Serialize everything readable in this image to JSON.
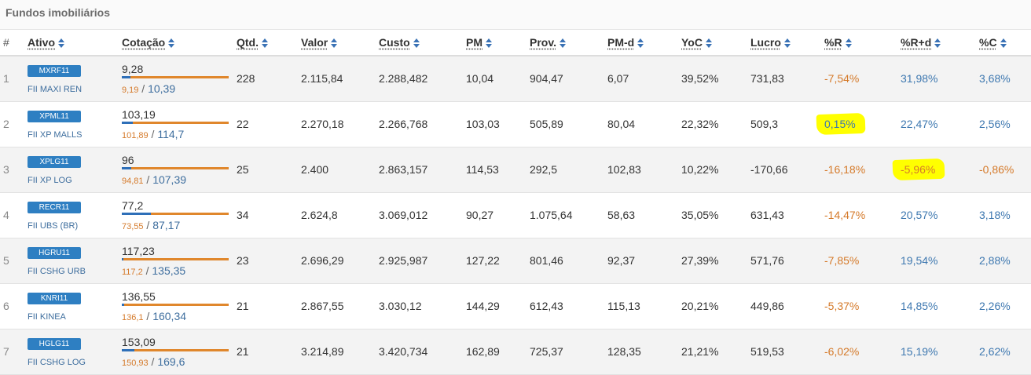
{
  "panel": {
    "title": "Fundos imobiliários"
  },
  "columns": [
    {
      "key": "num",
      "label": "#",
      "sortable": false
    },
    {
      "key": "ativo",
      "label": "Ativo",
      "sortable": true
    },
    {
      "key": "cotacao",
      "label": "Cotação",
      "sortable": true
    },
    {
      "key": "qtd",
      "label": "Qtd.",
      "sortable": true
    },
    {
      "key": "valor",
      "label": "Valor",
      "sortable": true
    },
    {
      "key": "custo",
      "label": "Custo",
      "sortable": true
    },
    {
      "key": "pm",
      "label": "PM",
      "sortable": true
    },
    {
      "key": "prov",
      "label": "Prov.",
      "sortable": true
    },
    {
      "key": "pmd",
      "label": "PM-d",
      "sortable": true
    },
    {
      "key": "yoc",
      "label": "YoC",
      "sortable": true
    },
    {
      "key": "lucro",
      "label": "Lucro",
      "sortable": true
    },
    {
      "key": "r",
      "label": "%R",
      "sortable": true
    },
    {
      "key": "rd",
      "label": "%R+d",
      "sortable": true
    },
    {
      "key": "c",
      "label": "%C",
      "sortable": true
    }
  ],
  "rows": [
    {
      "num": "1",
      "ticker": "MXRF11",
      "name": "FII MAXI REN",
      "price": "9,28",
      "min": "9,19",
      "max": "10,39",
      "range_pos": 0.08,
      "qtd": "228",
      "valor": "2.115,84",
      "custo": "2.288,482",
      "pm": "10,04",
      "prov": "904,47",
      "pmd": "6,07",
      "yoc": "39,52%",
      "lucro": "731,83",
      "r": "-7,54%",
      "rd": "31,98%",
      "c": "3,68%",
      "r_sign": "neg",
      "rd_sign": "pos",
      "c_sign": "pos",
      "r_hl": false,
      "rd_hl": false
    },
    {
      "num": "2",
      "ticker": "XPML11",
      "name": "FII XP MALLS",
      "price": "103,19",
      "min": "101,89",
      "max": "114,7",
      "range_pos": 0.1,
      "qtd": "22",
      "valor": "2.270,18",
      "custo": "2.266,768",
      "pm": "103,03",
      "prov": "505,89",
      "pmd": "80,04",
      "yoc": "22,32%",
      "lucro": "509,3",
      "r": "0,15%",
      "rd": "22,47%",
      "c": "2,56%",
      "r_sign": "pos",
      "rd_sign": "pos",
      "c_sign": "pos",
      "r_hl": true,
      "rd_hl": false
    },
    {
      "num": "3",
      "ticker": "XPLG11",
      "name": "FII XP LOG",
      "price": "96",
      "min": "94,81",
      "max": "107,39",
      "range_pos": 0.09,
      "qtd": "25",
      "valor": "2.400",
      "custo": "2.863,157",
      "pm": "114,53",
      "prov": "292,5",
      "pmd": "102,83",
      "yoc": "10,22%",
      "lucro": "-170,66",
      "r": "-16,18%",
      "rd": "-5,96%",
      "c": "-0,86%",
      "r_sign": "neg",
      "rd_sign": "neg",
      "c_sign": "neg",
      "r_hl": false,
      "rd_hl": true
    },
    {
      "num": "4",
      "ticker": "RECR11",
      "name": "FII UBS (BR)",
      "price": "77,2",
      "min": "73,55",
      "max": "87,17",
      "range_pos": 0.27,
      "qtd": "34",
      "valor": "2.624,8",
      "custo": "3.069,012",
      "pm": "90,27",
      "prov": "1.075,64",
      "pmd": "58,63",
      "yoc": "35,05%",
      "lucro": "631,43",
      "r": "-14,47%",
      "rd": "20,57%",
      "c": "3,18%",
      "r_sign": "neg",
      "rd_sign": "pos",
      "c_sign": "pos",
      "r_hl": false,
      "rd_hl": false
    },
    {
      "num": "5",
      "ticker": "HGRU11",
      "name": "FII CSHG URB",
      "price": "117,23",
      "min": "117,2",
      "max": "135,35",
      "range_pos": 0.002,
      "qtd": "23",
      "valor": "2.696,29",
      "custo": "2.925,987",
      "pm": "127,22",
      "prov": "801,46",
      "pmd": "92,37",
      "yoc": "27,39%",
      "lucro": "571,76",
      "r": "-7,85%",
      "rd": "19,54%",
      "c": "2,88%",
      "r_sign": "neg",
      "rd_sign": "pos",
      "c_sign": "pos",
      "r_hl": false,
      "rd_hl": false
    },
    {
      "num": "6",
      "ticker": "KNRI11",
      "name": "FII KINEA",
      "price": "136,55",
      "min": "136,1",
      "max": "160,34",
      "range_pos": 0.02,
      "qtd": "21",
      "valor": "2.867,55",
      "custo": "3.030,12",
      "pm": "144,29",
      "prov": "612,43",
      "pmd": "115,13",
      "yoc": "20,21%",
      "lucro": "449,86",
      "r": "-5,37%",
      "rd": "14,85%",
      "c": "2,26%",
      "r_sign": "neg",
      "rd_sign": "pos",
      "c_sign": "pos",
      "r_hl": false,
      "rd_hl": false
    },
    {
      "num": "7",
      "ticker": "HGLG11",
      "name": "FII CSHG LOG",
      "price": "153,09",
      "min": "150,93",
      "max": "169,6",
      "range_pos": 0.12,
      "qtd": "21",
      "valor": "3.214,89",
      "custo": "3.420,734",
      "pm": "162,89",
      "prov": "725,37",
      "pmd": "128,35",
      "yoc": "21,21%",
      "lucro": "519,53",
      "r": "-6,02%",
      "rd": "15,19%",
      "c": "2,62%",
      "r_sign": "neg",
      "rd_sign": "pos",
      "c_sign": "pos",
      "r_hl": false,
      "rd_hl": false
    }
  ],
  "colors": {
    "ticker_badge": "#2e7fc2",
    "negative": "#d57a2a",
    "positive": "#3e78b0",
    "highlight": "#ffff00",
    "bar_track": "#e0872c",
    "bar_fill": "#2e6fb8"
  },
  "icons": {
    "sort": "sort-arrows-icon"
  }
}
